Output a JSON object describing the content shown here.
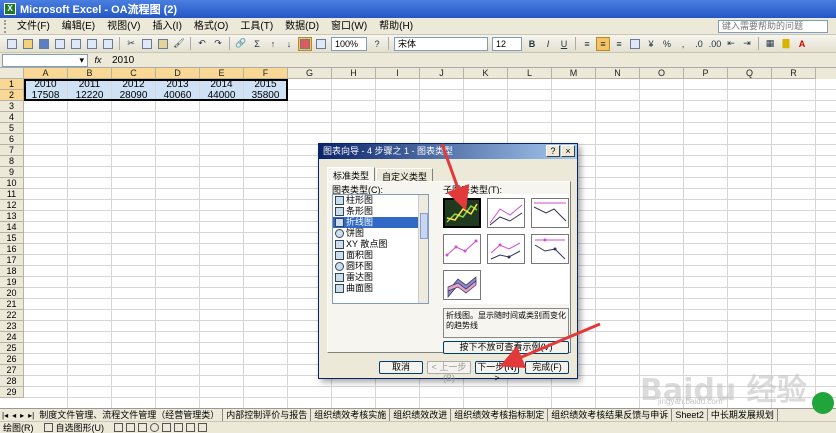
{
  "window": {
    "title": "Microsoft Excel - OA流程图 (2)"
  },
  "menu": {
    "items": [
      "文件(F)",
      "编辑(E)",
      "视图(V)",
      "插入(I)",
      "格式(O)",
      "工具(T)",
      "数据(D)",
      "窗口(W)",
      "帮助(H)"
    ],
    "help_placeholder": "键入需要帮助的问题"
  },
  "toolbar": {
    "zoom": "100%",
    "font": "宋体",
    "font_size": "12",
    "bold": "B",
    "italic": "I",
    "underline": "U",
    "currency": "%"
  },
  "formula_bar": {
    "fx": "fx",
    "value": "2010"
  },
  "columns": [
    "A",
    "B",
    "C",
    "D",
    "E",
    "F",
    "G",
    "H",
    "I",
    "J",
    "K",
    "L",
    "M",
    "N",
    "O",
    "P",
    "Q",
    "R"
  ],
  "rows": [
    "1",
    "2",
    "3",
    "4",
    "5",
    "6",
    "7",
    "8",
    "9",
    "10",
    "11",
    "12",
    "13",
    "14",
    "15",
    "16",
    "17",
    "18",
    "19",
    "20",
    "21",
    "22",
    "23",
    "24",
    "25",
    "26",
    "27",
    "28",
    "29"
  ],
  "cells": {
    "row1": [
      "2010",
      "2011",
      "2012",
      "2013",
      "2014",
      "2015"
    ],
    "row2": [
      "17508",
      "12220",
      "28090",
      "40060",
      "44000",
      "35800"
    ]
  },
  "dialog": {
    "title": "图表向导 - 4 步骤之 1 - 图表类型",
    "help_btn": "?",
    "close_btn": "×",
    "tabs": [
      "标准类型",
      "自定义类型"
    ],
    "chart_type_label": "图表类型(C):",
    "subtype_label": "子图表类型(T):",
    "chart_types": [
      "柱形图",
      "条形图",
      "折线图",
      "饼图",
      "XY 散点图",
      "面积图",
      "圆环图",
      "雷达图",
      "曲面图"
    ],
    "selected_type": "折线图",
    "description": "折线图。显示随时间或类别而变化的趋势线",
    "press_view_btn": "按下不放可查看示例(V)",
    "cancel_btn": "取消",
    "prev_btn": "< 上一步(B)",
    "next_btn": "下一步(N) >",
    "finish_btn": "完成(F)"
  },
  "sheet_tabs": [
    "制度文件管理、流程文件管理（经营管理类）",
    "内部控制评价与报告",
    "组织绩效考核实施",
    "组织绩效改进",
    "组织绩效考核指标制定",
    "组织绩效考核结果反馈与申诉",
    "Sheet2",
    "中长期发展规划"
  ],
  "drawbar": {
    "draw": "绘图(R)",
    "autoshape": "自选图形(U)"
  },
  "colors": {
    "title_bar": "#2457c5",
    "selection": "#cfe2f5",
    "arrow": "#e23a3a"
  },
  "watermark": {
    "main": "Baidu 经验",
    "sub": "jingyan.baidu.com"
  }
}
